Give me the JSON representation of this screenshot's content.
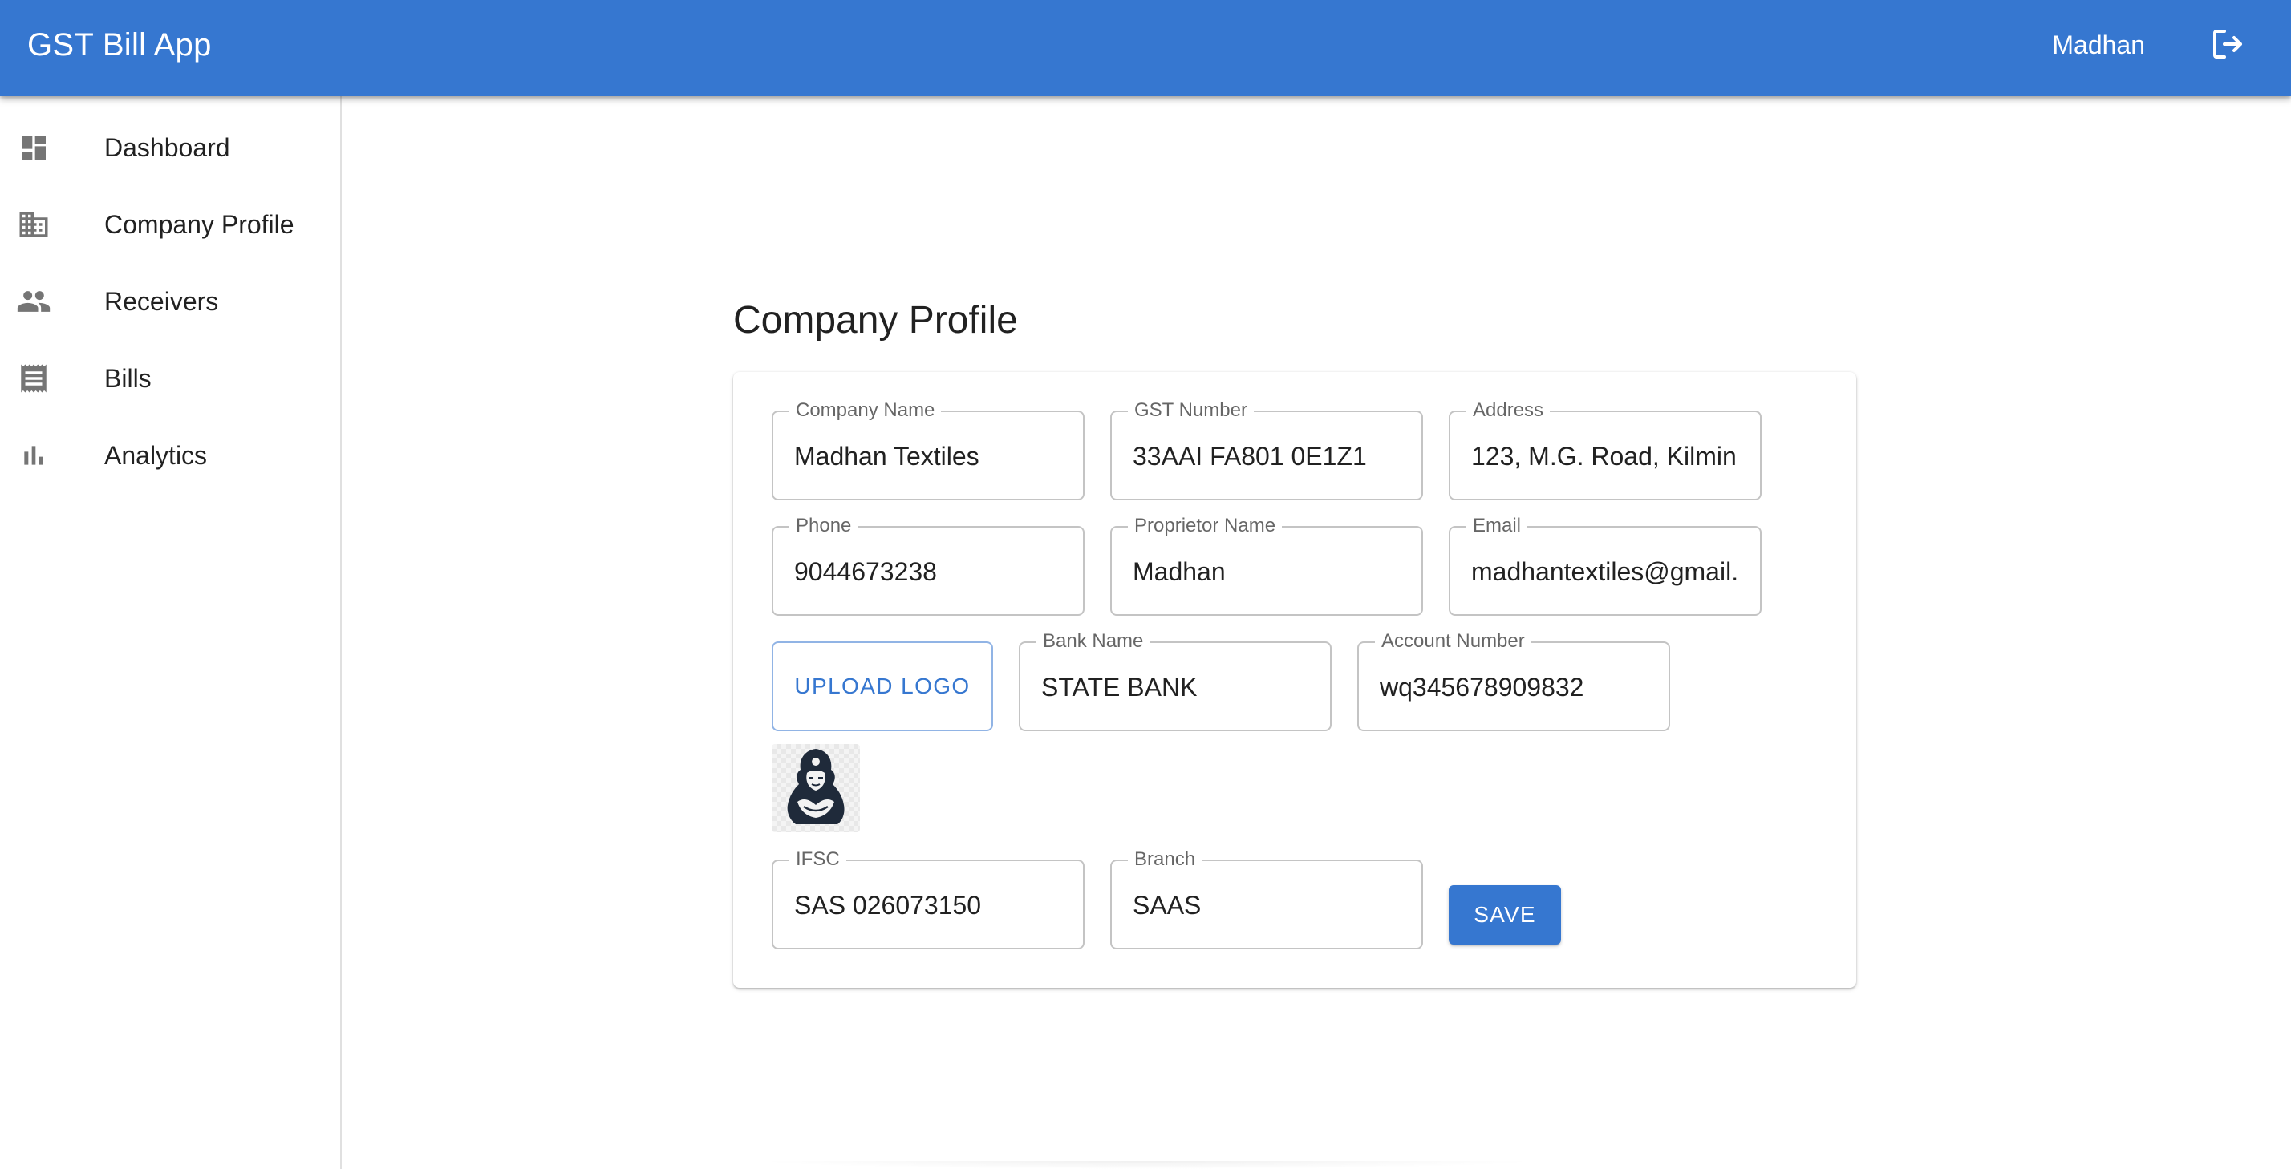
{
  "app": {
    "title": "GST Bill App",
    "user_name": "Madhan",
    "accent_color": "#3677d0"
  },
  "header": {
    "logout_icon": "logout-icon"
  },
  "sidebar": {
    "items": [
      {
        "label": "Dashboard",
        "icon": "dashboard-icon"
      },
      {
        "label": "Company Profile",
        "icon": "business-icon"
      },
      {
        "label": "Receivers",
        "icon": "people-icon"
      },
      {
        "label": "Bills",
        "icon": "receipt-icon"
      },
      {
        "label": "Analytics",
        "icon": "bar-chart-icon"
      }
    ]
  },
  "main": {
    "page_title": "Company Profile",
    "form": {
      "company_name": {
        "label": "Company Name",
        "value": "Madhan Textiles"
      },
      "gst_number": {
        "label": "GST Number",
        "value": "33AAI FA801 0E1Z1"
      },
      "address": {
        "label": "Address",
        "value": "123, M.G. Road, Kilmin"
      },
      "phone": {
        "label": "Phone",
        "value": "9044673238"
      },
      "proprietor_name": {
        "label": "Proprietor Name",
        "value": "Madhan"
      },
      "email": {
        "label": "Email",
        "value": "madhantextiles@gmail."
      },
      "upload_logo_label": "UPLOAD LOGO",
      "bank_name": {
        "label": "Bank Name",
        "value": "STATE BANK"
      },
      "account_number": {
        "label": "Account Number",
        "value": "wq345678909832"
      },
      "ifsc": {
        "label": "IFSC",
        "value": "SAS 026073150"
      },
      "branch": {
        "label": "Branch",
        "value": "SAAS"
      },
      "save_label": "SAVE"
    }
  }
}
